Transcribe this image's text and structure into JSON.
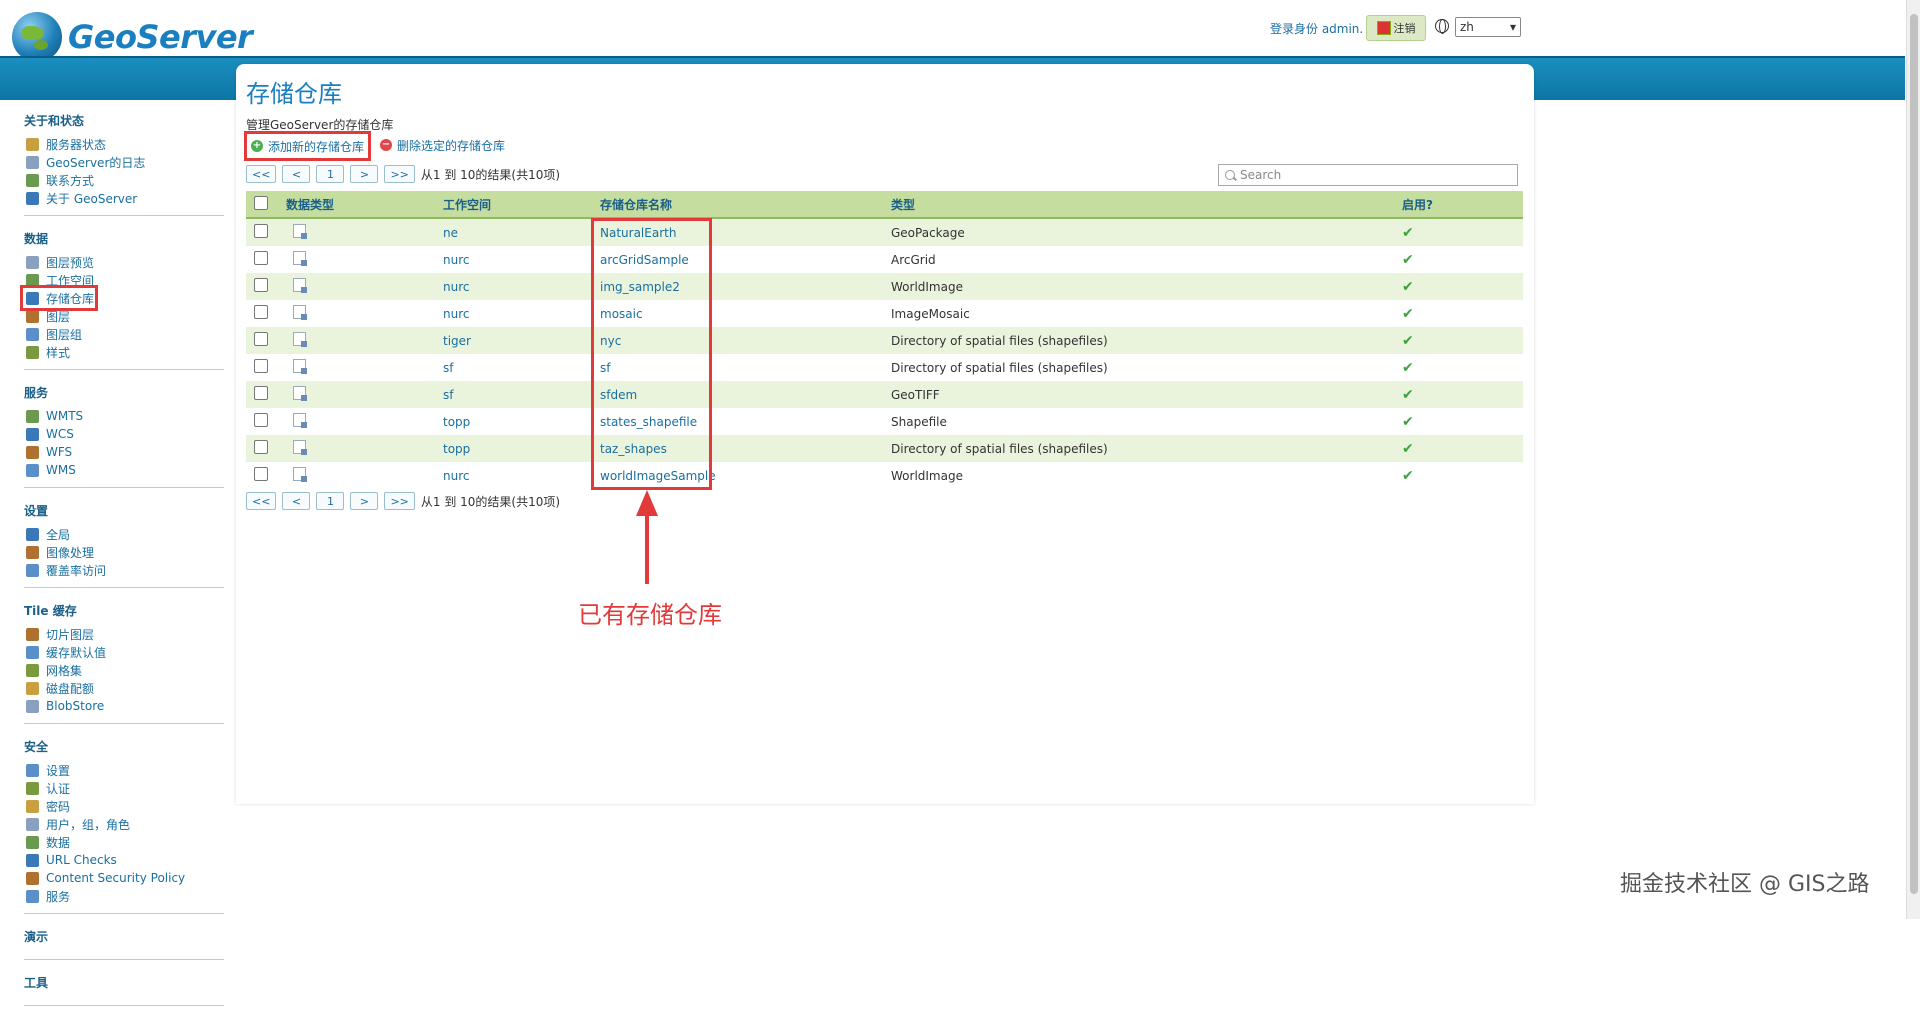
{
  "app": {
    "logo_text": "GeoServer"
  },
  "header": {
    "login_text": "登录身份 admin.",
    "logout_label": "注销",
    "language": "zh"
  },
  "sidebar": {
    "sections": [
      {
        "title": "关于和状态",
        "items": [
          {
            "label": "服务器状态",
            "icon": "server-status-icon"
          },
          {
            "label": "GeoServer的日志",
            "icon": "log-icon"
          },
          {
            "label": "联系方式",
            "icon": "contact-icon"
          },
          {
            "label": "关于 GeoServer",
            "icon": "about-icon"
          }
        ]
      },
      {
        "title": "数据",
        "items": [
          {
            "label": "图层预览",
            "icon": "layer-preview-icon"
          },
          {
            "label": "工作空间",
            "icon": "workspace-icon"
          },
          {
            "label": "存储仓库",
            "icon": "store-icon",
            "active": true
          },
          {
            "label": "图层",
            "icon": "layer-icon"
          },
          {
            "label": "图层组",
            "icon": "layer-group-icon"
          },
          {
            "label": "样式",
            "icon": "style-icon"
          }
        ]
      },
      {
        "title": "服务",
        "items": [
          {
            "label": "WMTS",
            "icon": "wmts-icon"
          },
          {
            "label": "WCS",
            "icon": "wcs-icon"
          },
          {
            "label": "WFS",
            "icon": "wfs-icon"
          },
          {
            "label": "WMS",
            "icon": "wms-icon"
          }
        ]
      },
      {
        "title": "设置",
        "items": [
          {
            "label": "全局",
            "icon": "global-icon"
          },
          {
            "label": "图像处理",
            "icon": "image-processing-icon"
          },
          {
            "label": "覆盖率访问",
            "icon": "coverage-access-icon"
          }
        ]
      },
      {
        "title": "Tile 缓存",
        "items": [
          {
            "label": "切片图层",
            "icon": "tile-layers-icon"
          },
          {
            "label": "缓存默认值",
            "icon": "cache-defaults-icon"
          },
          {
            "label": "网格集",
            "icon": "gridsets-icon"
          },
          {
            "label": "磁盘配额",
            "icon": "disk-quota-icon"
          },
          {
            "label": "BlobStore",
            "icon": "blobstore-icon"
          }
        ]
      },
      {
        "title": "安全",
        "items": [
          {
            "label": "设置",
            "icon": "security-settings-icon"
          },
          {
            "label": "认证",
            "icon": "authentication-icon"
          },
          {
            "label": "密码",
            "icon": "password-icon"
          },
          {
            "label": "用户，组，角色",
            "icon": "users-groups-roles-icon"
          },
          {
            "label": "数据",
            "icon": "data-security-icon"
          },
          {
            "label": "URL Checks",
            "icon": "url-checks-icon"
          },
          {
            "label": "Content Security Policy",
            "icon": "csp-icon"
          },
          {
            "label": "服务",
            "icon": "service-security-icon"
          }
        ]
      },
      {
        "title": "演示",
        "items": []
      },
      {
        "title": "工具",
        "items": []
      }
    ]
  },
  "main": {
    "title": "存储仓库",
    "description": "管理GeoServer的存储仓库",
    "add_label": "添加新的存储仓库",
    "remove_label": "删除选定的存储仓库",
    "pager": {
      "first": "<<",
      "prev": "<",
      "page": "1",
      "next": ">",
      "last": ">>",
      "summary": "从1 到 10的结果(共10项)"
    },
    "search_placeholder": "Search",
    "columns": [
      "数据类型",
      "工作空间",
      "存储仓库名称",
      "类型",
      "启用?"
    ],
    "rows": [
      {
        "workspace": "ne",
        "name": "NaturalEarth",
        "type": "GeoPackage",
        "kind": "vector"
      },
      {
        "workspace": "nurc",
        "name": "arcGridSample",
        "type": "ArcGrid",
        "kind": "raster"
      },
      {
        "workspace": "nurc",
        "name": "img_sample2",
        "type": "WorldImage",
        "kind": "raster"
      },
      {
        "workspace": "nurc",
        "name": "mosaic",
        "type": "ImageMosaic",
        "kind": "raster"
      },
      {
        "workspace": "tiger",
        "name": "nyc",
        "type": "Directory of spatial files (shapefiles)",
        "kind": "vector"
      },
      {
        "workspace": "sf",
        "name": "sf",
        "type": "Directory of spatial files (shapefiles)",
        "kind": "vector"
      },
      {
        "workspace": "sf",
        "name": "sfdem",
        "type": "GeoTIFF",
        "kind": "raster"
      },
      {
        "workspace": "topp",
        "name": "states_shapefile",
        "type": "Shapefile",
        "kind": "vector"
      },
      {
        "workspace": "topp",
        "name": "taz_shapes",
        "type": "Directory of spatial files (shapefiles)",
        "kind": "vector"
      },
      {
        "workspace": "nurc",
        "name": "worldImageSample",
        "type": "WorldImage",
        "kind": "raster"
      }
    ],
    "enabled_mark": "✔"
  },
  "annotation": {
    "text": "已有存储仓库",
    "color": "#e23a3a"
  },
  "watermark": "掘金技术社区 @ GIS之路",
  "colors": {
    "brand_blue": "#1a7fc0",
    "header_green": "#c5dea0",
    "row_alt": "#eaf3dc",
    "highlight_red": "#e23a3a"
  }
}
